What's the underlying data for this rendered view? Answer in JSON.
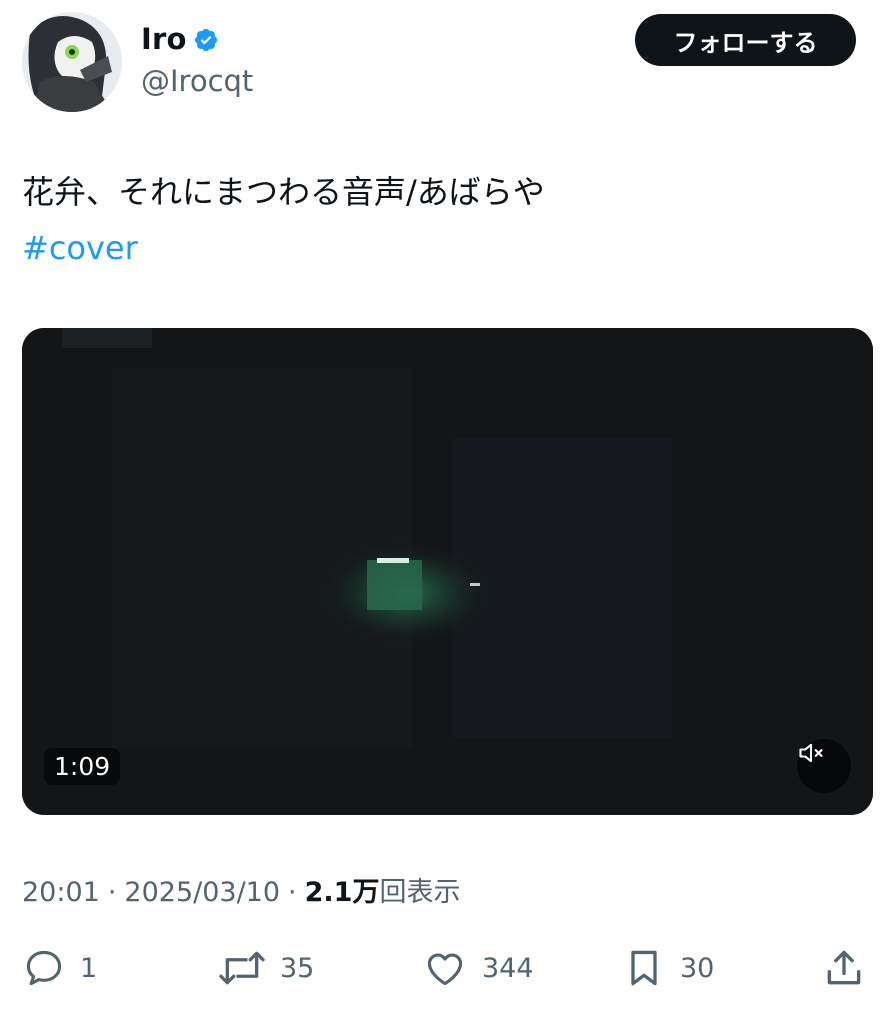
{
  "author": {
    "display_name": "Iro",
    "handle": "@Irocqt",
    "verified_icon": "verified-badge-icon",
    "badge_color": "#1d9bf0"
  },
  "follow_button": {
    "label": "フォローする"
  },
  "tweet": {
    "text": "花弁、それにまつわる音声/あばらや",
    "hashtag": "#cover",
    "hashtag_color": "#1d9bf0"
  },
  "video": {
    "duration": "1:09",
    "mute_icon": "muted-speaker-icon"
  },
  "meta": {
    "time": "20:01",
    "date": "2025/03/10",
    "separator": "·",
    "views_count": "2.1万",
    "views_label": "回表示"
  },
  "actions": {
    "reply": {
      "icon": "reply-icon",
      "count": "1"
    },
    "repost": {
      "icon": "repost-icon",
      "count": "35"
    },
    "like": {
      "icon": "heart-icon",
      "count": "344"
    },
    "bookmark": {
      "icon": "bookmark-icon",
      "count": "30"
    },
    "share": {
      "icon": "share-icon"
    }
  },
  "colors": {
    "text_primary": "#0f1419",
    "text_secondary": "#536471",
    "follow_bg": "#0f1419"
  }
}
